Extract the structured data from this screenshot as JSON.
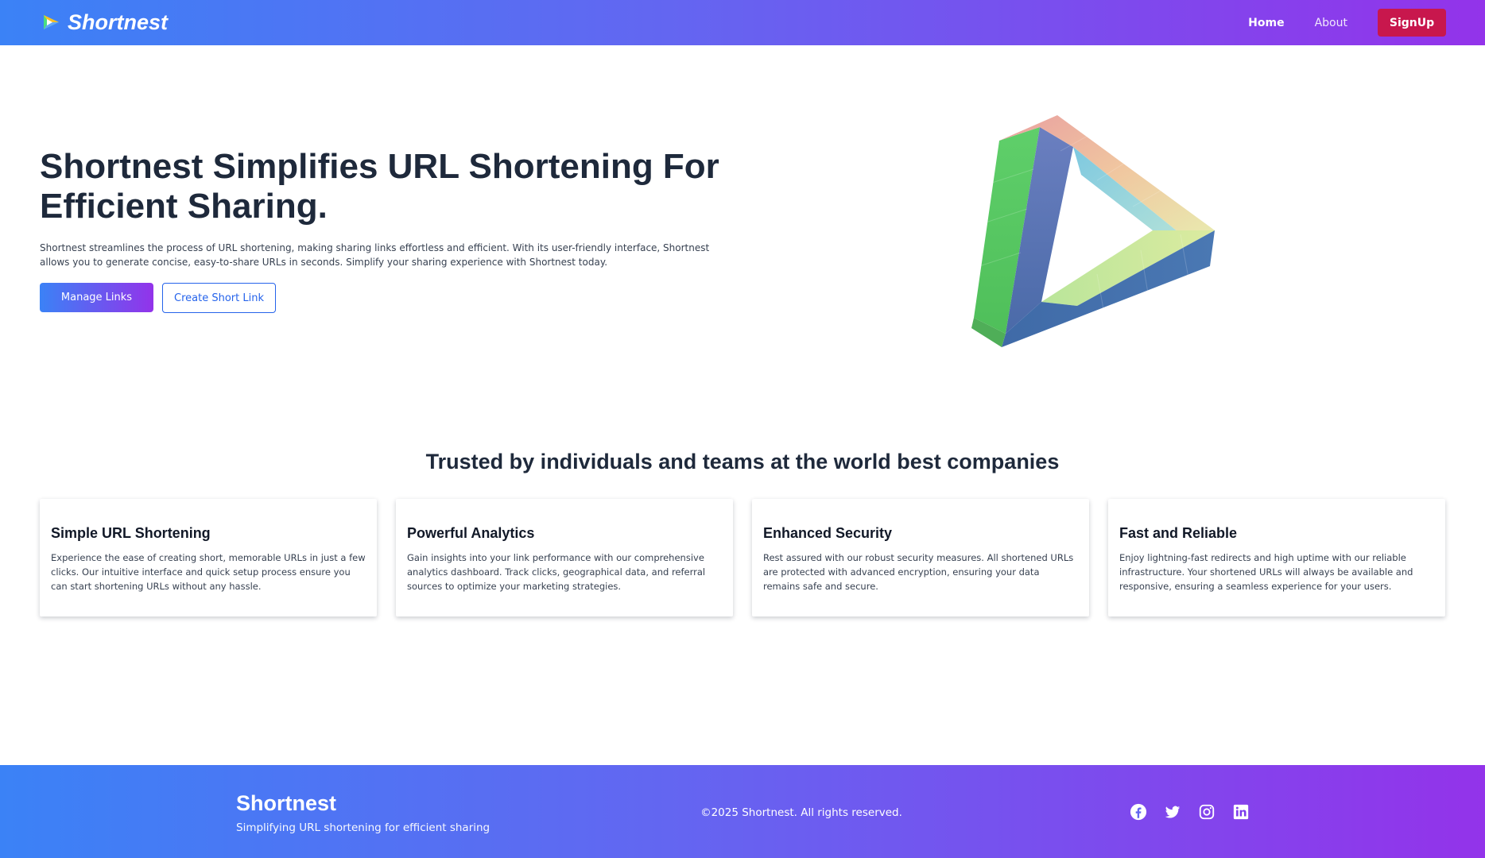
{
  "nav": {
    "brand": "Shortnest",
    "links": [
      {
        "label": "Home",
        "active": true
      },
      {
        "label": "About",
        "active": false
      }
    ],
    "signup_label": "SignUp"
  },
  "hero": {
    "title": "Shortnest Simplifies URL Shortening For Efficient Sharing.",
    "description": "Shortnest streamlines the process of URL shortening, making sharing links effortless and efficient. With its user-friendly interface, Shortnest allows you to generate concise, easy-to-share URLs in seconds. Simplify your sharing experience with Shortnest today.",
    "primary_button": "Manage Links",
    "secondary_button": "Create Short Link"
  },
  "trusted": {
    "title": "Trusted by individuals and teams at the world best companies"
  },
  "features": [
    {
      "title": "Simple URL Shortening",
      "description": "Experience the ease of creating short, memorable URLs in just a few clicks. Our intuitive interface and quick setup process ensure you can start shortening URLs without any hassle."
    },
    {
      "title": "Powerful Analytics",
      "description": "Gain insights into your link performance with our comprehensive analytics dashboard. Track clicks, geographical data, and referral sources to optimize your marketing strategies."
    },
    {
      "title": "Enhanced Security",
      "description": "Rest assured with our robust security measures. All shortened URLs are protected with advanced encryption, ensuring your data remains safe and secure."
    },
    {
      "title": "Fast and Reliable",
      "description": "Enjoy lightning-fast redirects and high uptime with our reliable infrastructure. Your shortened URLs will always be available and responsive, ensuring a seamless experience for your users."
    }
  ],
  "footer": {
    "brand": "Shortnest",
    "tagline": "Simplifying URL shortening for efficient sharing",
    "copyright": "©2025 Shortnest. All rights reserved.",
    "socials": [
      "facebook-icon",
      "twitter-icon",
      "instagram-icon",
      "linkedin-icon"
    ]
  },
  "colors": {
    "gradient_start": "#3b82f6",
    "gradient_end": "#9333ea",
    "signup": "#c8174d",
    "outline_accent": "#2563eb"
  }
}
